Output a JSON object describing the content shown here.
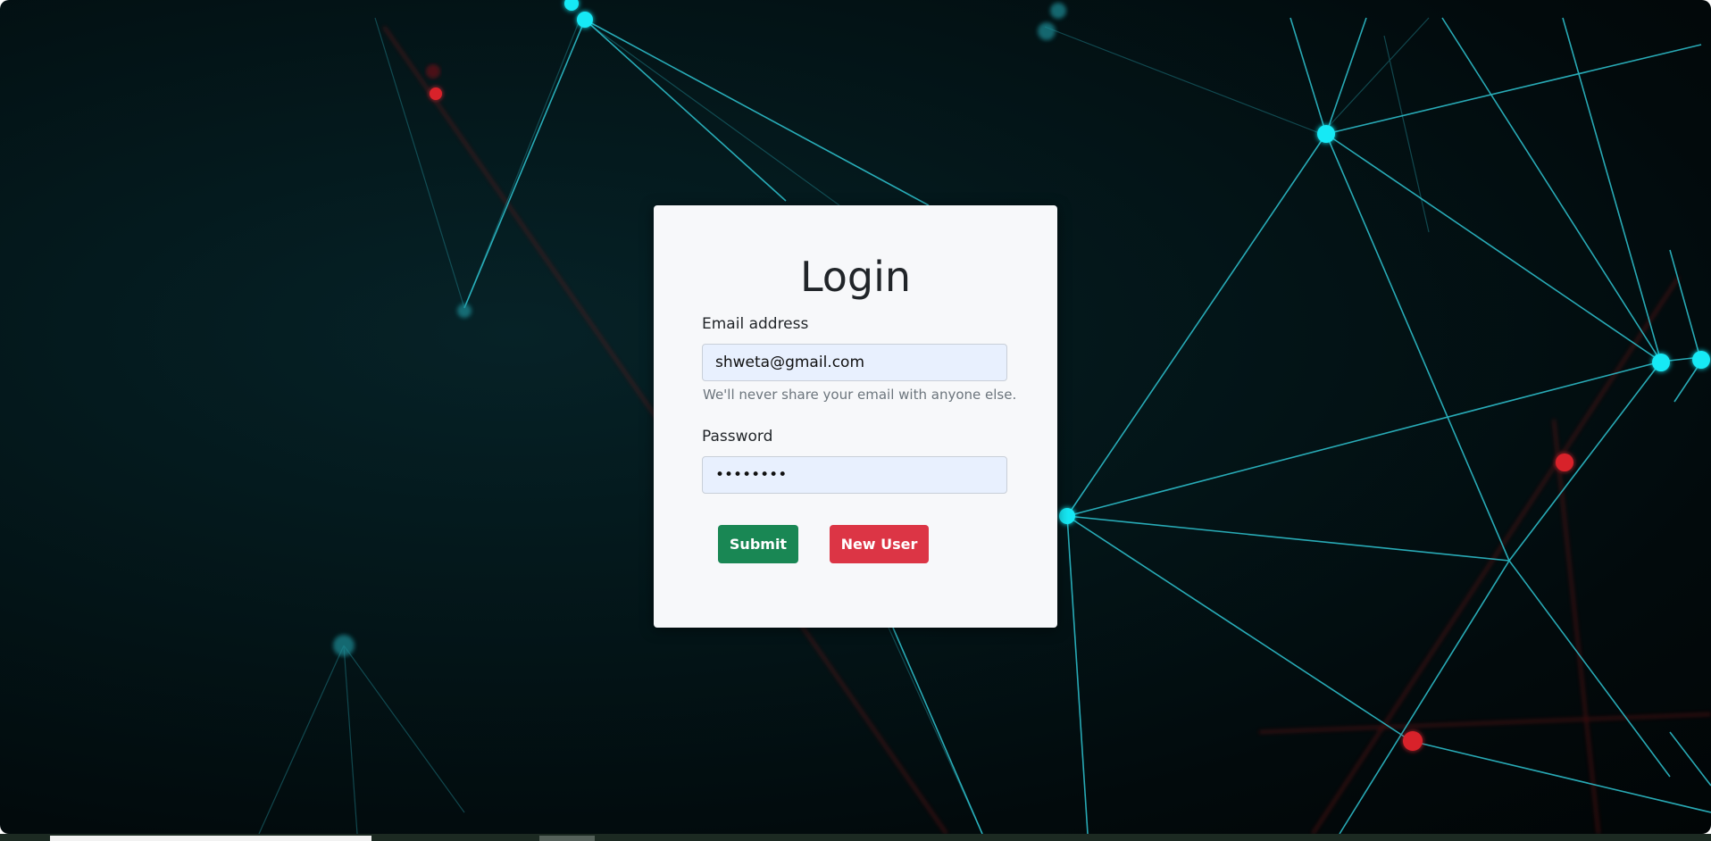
{
  "login": {
    "title": "Login",
    "email_label": "Email address",
    "email_value": "shweta@gmail.com",
    "email_help": "We'll never share your email with anyone else.",
    "password_label": "Password",
    "password_value": "shweta12",
    "submit_label": "Submit",
    "new_user_label": "New User"
  },
  "colors": {
    "background": "#031417",
    "network_line": "#2fc6d3",
    "network_node": "#19e9f5",
    "red_accent": "#d8222c",
    "card": "#f7f8fa",
    "input_fill": "#e8f0fe",
    "submit_button": "#198754",
    "new_user_button": "#dc3545"
  }
}
